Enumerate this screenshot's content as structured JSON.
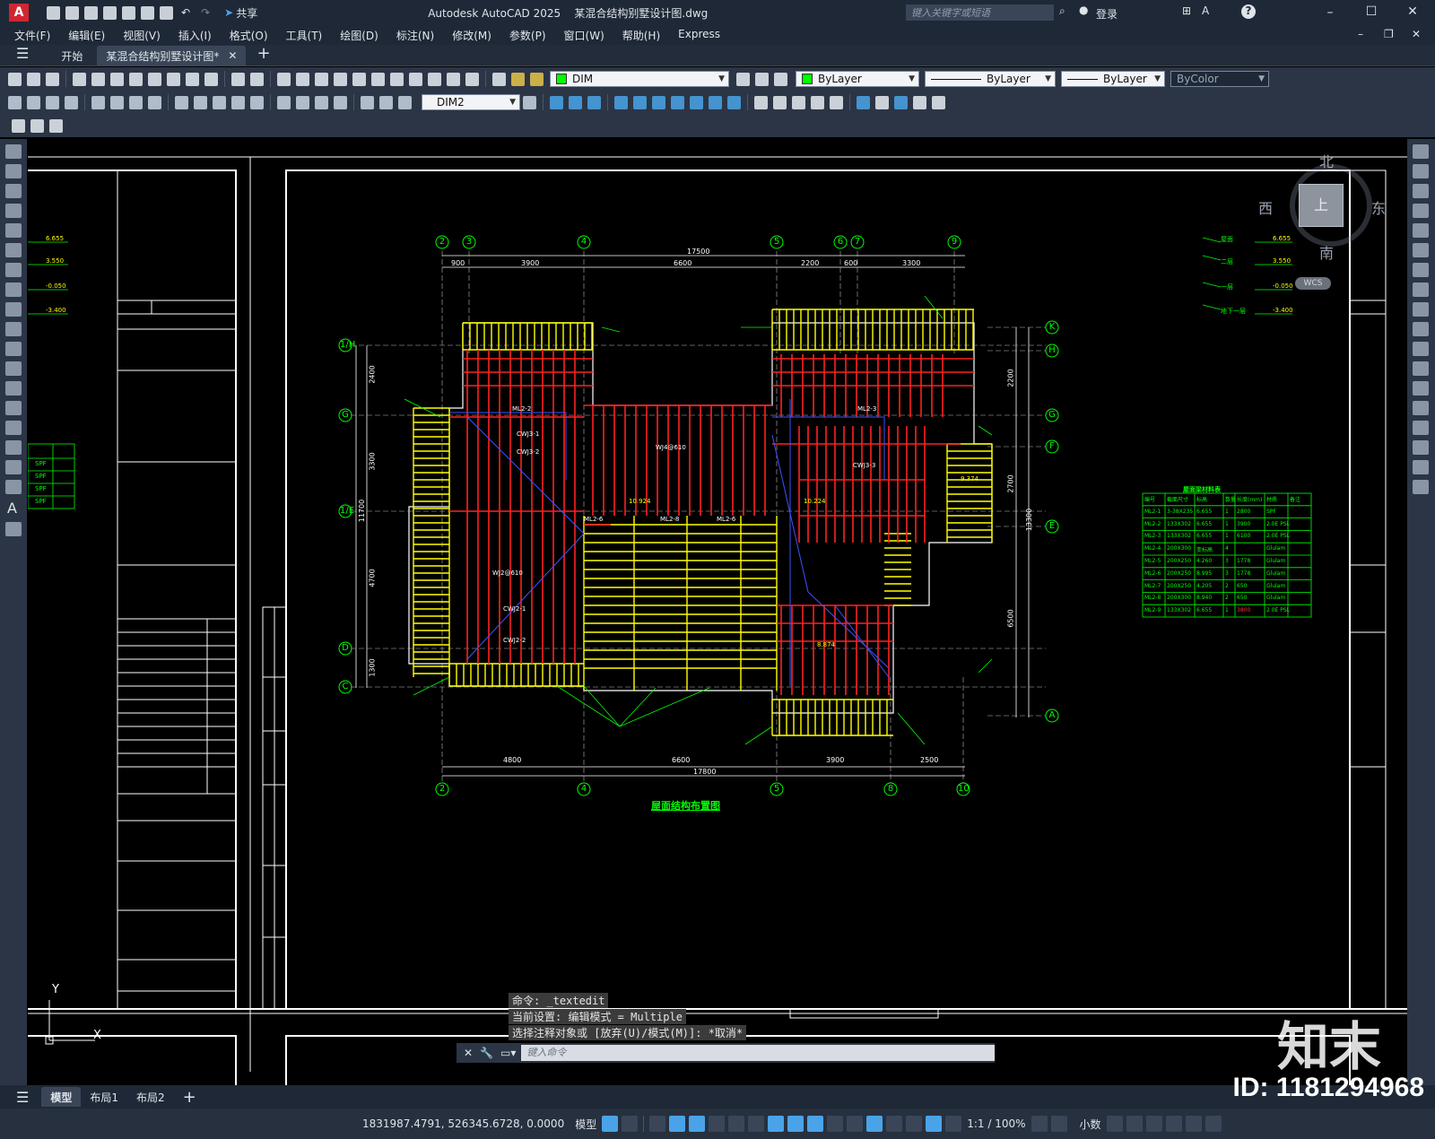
{
  "titlebar": {
    "app_letter": "A",
    "share_label": "共享",
    "title": "Autodesk AutoCAD 2025    某混合结构别墅设计图.dwg",
    "search_placeholder": "键入关键字或短语",
    "login_label": "登录",
    "help_label": "?"
  },
  "menu": [
    "文件(F)",
    "编辑(E)",
    "视图(V)",
    "插入(I)",
    "格式(O)",
    "工具(T)",
    "绘图(D)",
    "标注(N)",
    "修改(M)",
    "参数(P)",
    "窗口(W)",
    "帮助(H)",
    "Express"
  ],
  "doc_tabs": {
    "start": "开始",
    "active": "某混合结构别墅设计图*"
  },
  "toolbar": {
    "layer_name": "DIM",
    "color_value": "ByLayer",
    "linetype_value": "ByLayer",
    "lineweight_value": "ByLayer",
    "plotstyle_value": "ByColor",
    "dimstyle_value": "DIM2"
  },
  "viewcube": {
    "north": "北",
    "south": "南",
    "east": "东",
    "west": "西",
    "face": "上",
    "wcs": "WCS"
  },
  "ucs": {
    "y": "Y",
    "x": "X"
  },
  "drawing": {
    "plan_title": "屋面结构布置图",
    "grid_top": [
      "2",
      "3",
      "4",
      "5",
      "6",
      "7",
      "9"
    ],
    "grid_bottom": [
      "2",
      "4",
      "5",
      "8",
      "10"
    ],
    "grid_left": [
      "1/H",
      "G",
      "1/E",
      "D",
      "C"
    ],
    "grid_right": [
      "K",
      "H",
      "G",
      "F",
      "E",
      "A"
    ],
    "dims_top_total": "17500",
    "dims_top": [
      "900",
      "3900",
      "6600",
      "2200",
      "600",
      "3300"
    ],
    "dims_bottom": [
      "4800",
      "6600",
      "3900",
      "2500"
    ],
    "dims_bottom_total": "17800",
    "dims_left": [
      "2400",
      "3300",
      "4700",
      "1300"
    ],
    "dims_left_total": "11700",
    "dims_right": [
      "2200",
      "2700",
      "6500"
    ],
    "dims_right_total": "13300",
    "labels": [
      "WJ4@610",
      "WJ2@610",
      "ML2-6",
      "ML2-8",
      "ML2-6",
      "ML2-3",
      "ML2-2",
      "CWJ3-1",
      "CWJ3-2",
      "CWJ3-3",
      "CWJ2-1",
      "CWJ2-2",
      "10.924",
      "10.224",
      "9.374",
      "8.874"
    ],
    "elevations_left": [
      "6.655",
      "3.550",
      "-0.050",
      "-3.400"
    ],
    "elevations_right": [
      "屋面",
      "二层",
      "一层",
      "地下一层"
    ],
    "elevations_right_values": [
      "6.655",
      "3.550",
      "-0.050",
      "-3.400"
    ],
    "small_table_vals": [
      "SPF",
      "SPF",
      "SPF",
      "SPF"
    ],
    "table_title": "屋面梁材料表",
    "table_header": [
      "编号",
      "截面尺寸",
      "标高",
      "数量",
      "长度(mm)",
      "材质",
      "备注"
    ],
    "table_rows": [
      [
        "ML2-1",
        "3-38X235",
        "6.655",
        "1",
        "2800",
        "SPF",
        ""
      ],
      [
        "ML2-2",
        "133X302",
        "6.655",
        "1",
        "3900",
        "2.0E PSL",
        ""
      ],
      [
        "ML2-3",
        "133X302",
        "6.655",
        "1",
        "6100",
        "2.0E PSL",
        ""
      ],
      [
        "ML2-4",
        "200X300",
        "变标高",
        "4",
        "",
        "Glulam",
        ""
      ],
      [
        "ML2-5",
        "200X250",
        "4.260",
        "3",
        "1778",
        "Glulam",
        ""
      ],
      [
        "ML2-6",
        "200X250",
        "8.995",
        "3",
        "1778",
        "Glulam",
        ""
      ],
      [
        "ML2-7",
        "200X250",
        "4.205",
        "2",
        "650",
        "Glulam",
        ""
      ],
      [
        "ML2-8",
        "200X300",
        "8.940",
        "2",
        "650",
        "Glulam",
        ""
      ],
      [
        "ML2-9",
        "133X302",
        "6.655",
        "1",
        "3800",
        "2.0E PSL",
        ""
      ]
    ]
  },
  "command": {
    "line1": "命令: _textedit",
    "line2": "当前设置: 编辑模式 = Multiple",
    "line3": "选择注释对象或 [放弃(U)/模式(M)]: *取消*",
    "input_placeholder": "键入命令"
  },
  "layout_tabs": [
    "模型",
    "布局1",
    "布局2"
  ],
  "status": {
    "coords": "1831987.4791, 526345.6728, 0.0000",
    "space": "模型",
    "scale": "1:1 / 100%",
    "units": "小数"
  },
  "watermark": {
    "logo": "知末",
    "id": "ID: 1181294968"
  }
}
